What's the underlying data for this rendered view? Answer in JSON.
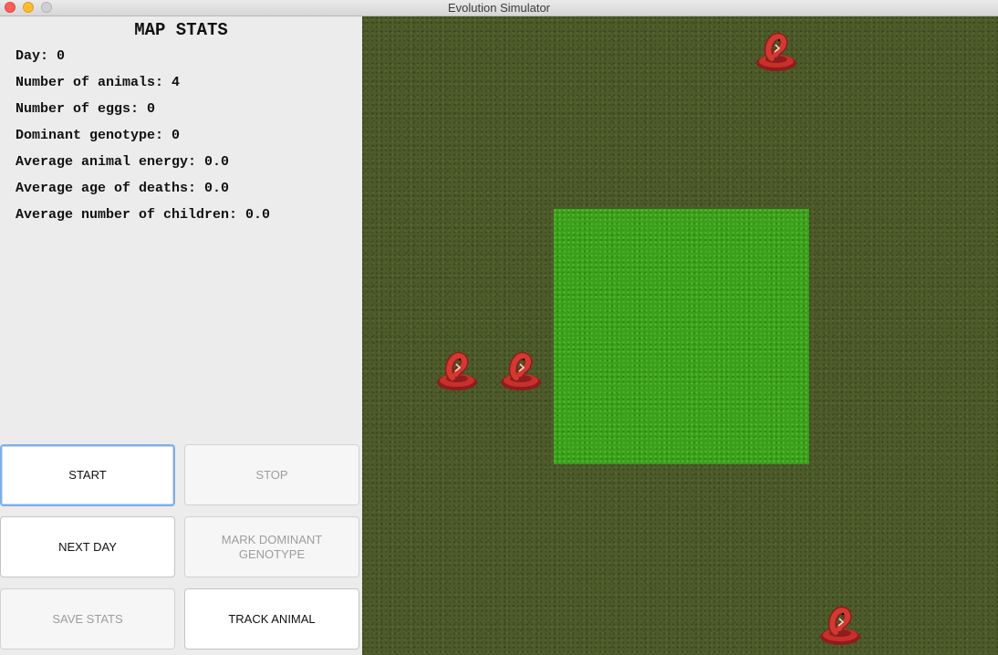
{
  "window": {
    "title": "Evolution Simulator"
  },
  "stats": {
    "heading": "MAP STATS",
    "lines": [
      "Day: 0",
      "Number of animals: 4",
      "Number of eggs: 0",
      "Dominant genotype: 0",
      "Average animal energy: 0.0",
      "Average age of deaths: 0.0",
      "Average number of children: 0.0"
    ]
  },
  "buttons": {
    "start": "START",
    "stop": "STOP",
    "next_day": "NEXT DAY",
    "mark_dominant": "MARK DOMINANT GENOTYPE",
    "save_stats": "SAVE STATS",
    "track_animal": "TRACK ANIMAL"
  },
  "map": {
    "steppe_color": "#4d5a2a",
    "jungle_color": "#3aa01b",
    "animal_icon": "red-snake-icon",
    "animal_count": 4
  }
}
